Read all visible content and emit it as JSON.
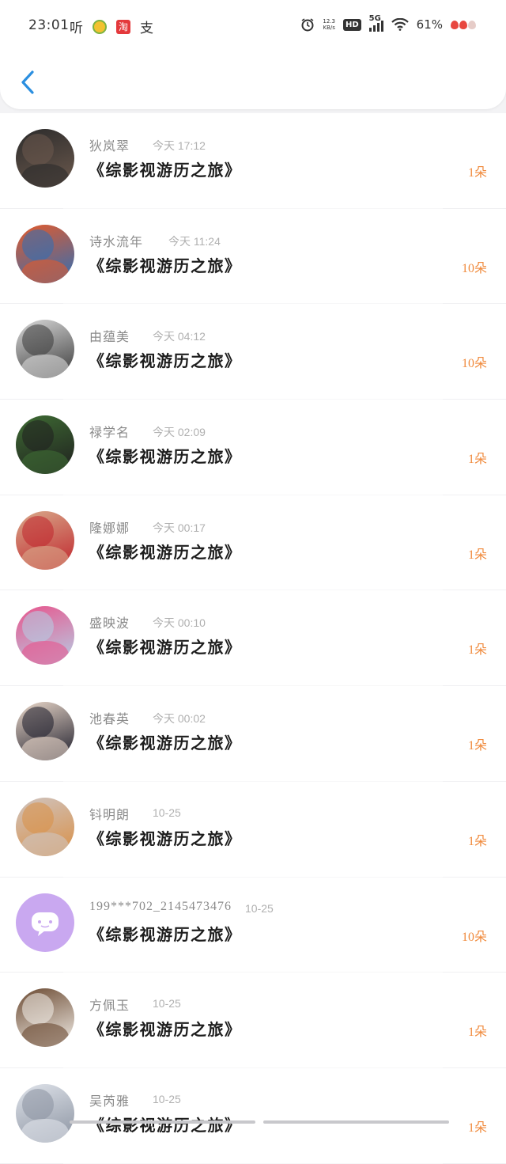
{
  "status_bar": {
    "time": "23:01",
    "left_glyphs": [
      "听",
      "支"
    ],
    "taobao_glyph": "淘",
    "net_speed_value": "12.3",
    "net_speed_unit": "KB/s",
    "hd": "HD",
    "network": "5G",
    "battery": "61%",
    "icons": [
      "app-icon",
      "taobao-icon",
      "alarm-icon",
      "hd-icon",
      "signal-icon",
      "wifi-icon",
      "battery-icon"
    ]
  },
  "colors": {
    "accent": "#2b8fe0",
    "gift_count": "#f08a3c",
    "username": "#8a8a8a",
    "time": "#b0b0b0"
  },
  "list": [
    {
      "username": "狄岚翠",
      "time": "今天 17:12",
      "book": "《综影视游历之旅》",
      "gift": "1朵",
      "avatar_colors": [
        "#2b2b2b",
        "#6d5a4e"
      ]
    },
    {
      "username": "诗水流年",
      "time": "今天 11:24",
      "book": "《综影视游历之旅》",
      "gift": "10朵",
      "avatar_colors": [
        "#e35a2b",
        "#2c6fb8"
      ]
    },
    {
      "username": "由蕴美",
      "time": "今天 04:12",
      "book": "《综影视游历之旅》",
      "gift": "10朵",
      "avatar_colors": [
        "#d8d8d8",
        "#3a3a3a"
      ]
    },
    {
      "username": "禄学名",
      "time": "今天 02:09",
      "book": "《综影视游历之旅》",
      "gift": "1朵",
      "avatar_colors": [
        "#3e6b33",
        "#1f1f1f"
      ]
    },
    {
      "username": "隆娜娜",
      "time": "今天 00:17",
      "book": "《综影视游历之旅》",
      "gift": "1朵",
      "avatar_colors": [
        "#d8a98a",
        "#c0242c"
      ]
    },
    {
      "username": "盛映波",
      "time": "今天 00:10",
      "book": "《综影视游历之旅》",
      "gift": "1朵",
      "avatar_colors": [
        "#e8548c",
        "#b5cfe6"
      ]
    },
    {
      "username": "池春英",
      "time": "今天 00:02",
      "book": "《综影视游历之旅》",
      "gift": "1朵",
      "avatar_colors": [
        "#e9d7c9",
        "#1c1c2a"
      ]
    },
    {
      "username": "钭明朗",
      "time": "10-25",
      "book": "《综影视游历之旅》",
      "gift": "1朵",
      "avatar_colors": [
        "#cfc4c0",
        "#d98f45"
      ]
    },
    {
      "username": "199***702_2145473476",
      "time": "10-25",
      "book": "《综影视游历之旅》",
      "gift": "10朵",
      "avatar_colors": [
        "#c9a8f0",
        "#c9a8f0"
      ]
    },
    {
      "username": "方佩玉",
      "time": "10-25",
      "book": "《综影视游历之旅》",
      "gift": "1朵",
      "avatar_colors": [
        "#6b4a32",
        "#f3efe9"
      ]
    },
    {
      "username": "吴芮雅",
      "time": "10-25",
      "book": "《综影视游历之旅》",
      "gift": "1朵",
      "avatar_colors": [
        "#dfe3ea",
        "#8a92a0"
      ]
    }
  ]
}
